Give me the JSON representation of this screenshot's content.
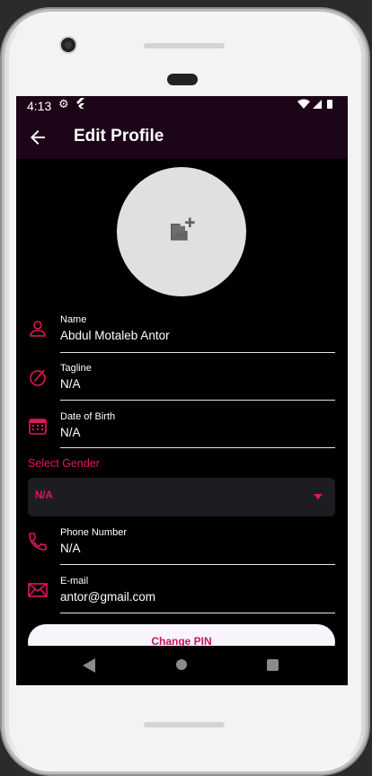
{
  "status": {
    "time": "4:13"
  },
  "appbar": {
    "title": "Edit Profile"
  },
  "fields": [
    {
      "label": "Name",
      "value": "Abdul Motaleb Antor"
    },
    {
      "label": "Tagline",
      "value": "N/A"
    },
    {
      "label": "Date of Birth",
      "value": "N/A"
    },
    {
      "label": "Phone Number",
      "value": "N/A"
    },
    {
      "label": "E-mail",
      "value": "antor@gmail.com"
    }
  ],
  "gender": {
    "label": "Select Gender",
    "selected": "N/A"
  },
  "change_pin": {
    "label": "Change PIN"
  },
  "colors": {
    "accent": "#e01858",
    "appbar": "#1c0519",
    "background": "#000000"
  },
  "icons": [
    "back-arrow-icon",
    "add-photo-icon",
    "person-icon",
    "tagline-icon",
    "calendar-icon",
    "phone-icon",
    "email-icon",
    "chevron-down-icon"
  ]
}
